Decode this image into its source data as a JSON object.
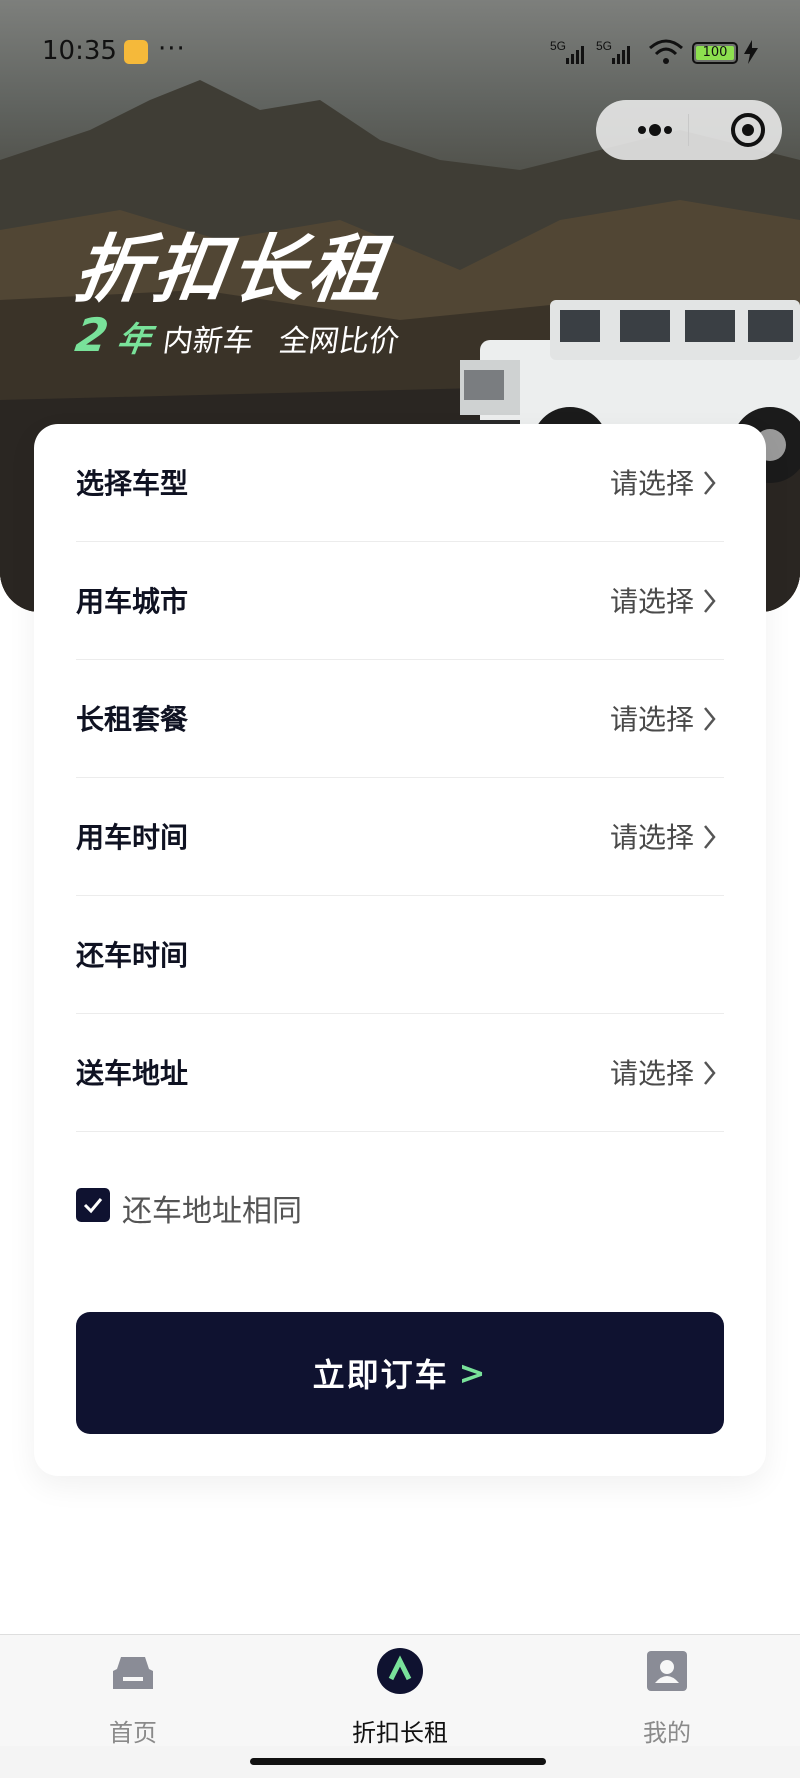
{
  "status_bar": {
    "time": "10:35",
    "more": "···",
    "net1": "5G",
    "net2": "5G",
    "battery": "100"
  },
  "hero": {
    "title": "折扣长租",
    "sub_num": "2",
    "sub_num_unit": "年",
    "sub_text1": "内新车",
    "sub_text2": "全网比价"
  },
  "form": {
    "rows": [
      {
        "label": "选择车型",
        "value": "请选择"
      },
      {
        "label": "用车城市",
        "value": "请选择"
      },
      {
        "label": "长租套餐",
        "value": "请选择"
      },
      {
        "label": "用车时间",
        "value": "请选择"
      },
      {
        "label": "还车时间",
        "value": ""
      },
      {
        "label": "送车地址",
        "value": "请选择"
      }
    ],
    "same_return_address": {
      "label": "还车地址相同",
      "checked": true
    },
    "submit_label": "立即订车",
    "submit_arrow": ">"
  },
  "tabbar": {
    "items": [
      {
        "label": "首页",
        "icon": "car-icon",
        "active": false
      },
      {
        "label": "折扣长租",
        "icon": "caret-up-icon",
        "active": true
      },
      {
        "label": "我的",
        "icon": "person-icon",
        "active": false
      }
    ]
  },
  "colors": {
    "primary": "#0f1230",
    "accent": "#79e29a"
  }
}
